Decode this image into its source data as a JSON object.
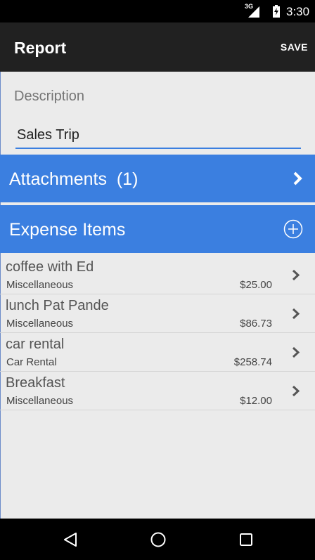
{
  "status_bar": {
    "network": "3G",
    "time": "3:30"
  },
  "app_bar": {
    "title": "Report",
    "save_label": "SAVE"
  },
  "form": {
    "description_label": "Description",
    "description_value": "Sales Trip"
  },
  "attachments": {
    "label": "Attachments  (1)"
  },
  "expense_items": {
    "label": "Expense Items",
    "items": [
      {
        "name": "coffee with Ed",
        "category": "Miscellaneous",
        "amount": "$25.00"
      },
      {
        "name": "lunch Pat Pande",
        "category": "Miscellaneous",
        "amount": "$86.73"
      },
      {
        "name": "car rental",
        "category": "Car Rental",
        "amount": "$258.74"
      },
      {
        "name": "Breakfast",
        "category": "Miscellaneous",
        "amount": "$12.00"
      }
    ]
  },
  "icons": {
    "status": [
      "signal-icon",
      "battery-icon"
    ],
    "nav": [
      "back-icon",
      "home-icon",
      "recent-apps-icon"
    ],
    "rows": [
      "chevron-right-icon",
      "add-circle-icon"
    ]
  },
  "colors": {
    "accent": "#3b7fe0",
    "app_bar": "#212121",
    "background": "#ebebeb"
  }
}
